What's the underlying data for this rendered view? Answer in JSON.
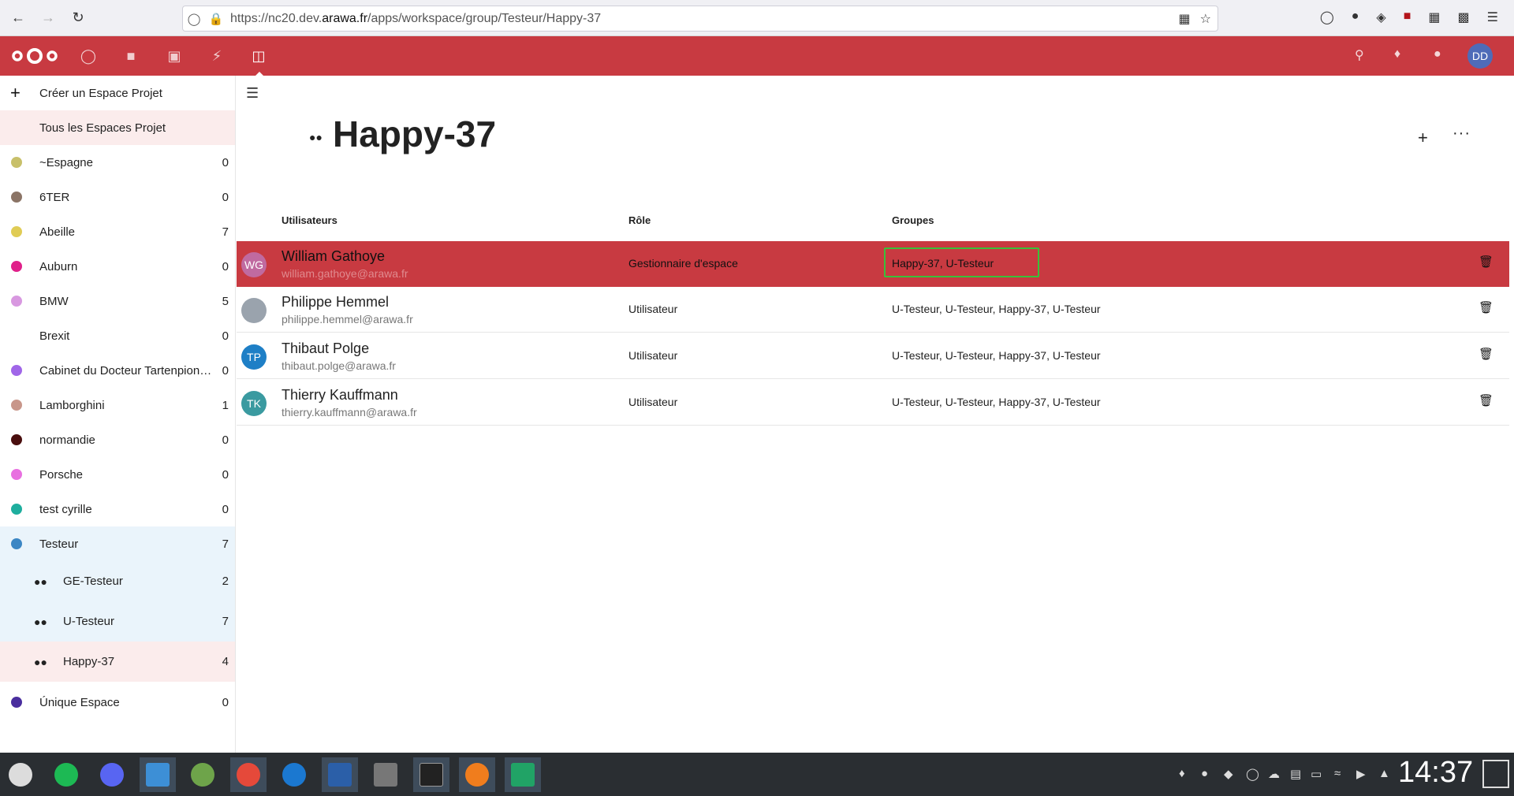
{
  "browser": {
    "url_prefix": "https://nc20.dev.",
    "url_domain": "arawa.fr",
    "url_path": "/apps/workspace/group/Testeur/Happy-37"
  },
  "header": {
    "user_initials": "DD",
    "apps": [
      "dashboard-icon",
      "files-icon",
      "photos-icon",
      "activity-icon",
      "workspace-icon"
    ]
  },
  "sidebar": {
    "create_label": "Créer un Espace Projet",
    "all_label": "Tous les Espaces Projet",
    "spaces": [
      {
        "name": "~Espagne",
        "count": "0",
        "color": "#c8c06a"
      },
      {
        "name": "6TER",
        "count": "0",
        "color": "#8b7466"
      },
      {
        "name": "Abeille",
        "count": "7",
        "color": "#e0cc55"
      },
      {
        "name": "Auburn",
        "count": "0",
        "color": "#e0208a"
      },
      {
        "name": "BMW",
        "count": "5",
        "color": "#d898e0"
      },
      {
        "name": "Brexit",
        "count": "0",
        "color": ""
      },
      {
        "name": "Cabinet du Docteur Tartenpion et ...",
        "count": "0",
        "color": "#a066e8"
      },
      {
        "name": "Lamborghini",
        "count": "1",
        "color": "#c8968a"
      },
      {
        "name": "normandie",
        "count": "0",
        "color": "#4a0e0e"
      },
      {
        "name": "Porsche",
        "count": "0",
        "color": "#e870e0"
      },
      {
        "name": "test cyrille",
        "count": "0",
        "color": "#1eae9e"
      },
      {
        "name": "Testeur",
        "count": "7",
        "color": "#3b86c4"
      }
    ],
    "subgroups": [
      {
        "name": "GE-Testeur",
        "count": "2"
      },
      {
        "name": "U-Testeur",
        "count": "7"
      },
      {
        "name": "Happy-37",
        "count": "4"
      }
    ],
    "last_space": {
      "name": "Únique Espace",
      "count": "0",
      "color": "#4a2e9e"
    }
  },
  "main": {
    "title": "Happy-37",
    "columns": {
      "users": "Utilisateurs",
      "role": "Rôle",
      "groups": "Groupes"
    },
    "rows": [
      {
        "initials": "WG",
        "avatar_color": "#c06aa0",
        "name": "William Gathoye",
        "email": "william.gathoye@arawa.fr",
        "role": "Gestionnaire d'espace",
        "groups": "Happy-37, U-Testeur"
      },
      {
        "initials": "",
        "avatar_color": "#9aa3ad",
        "name": "Philippe Hemmel",
        "email": "philippe.hemmel@arawa.fr",
        "role": "Utilisateur",
        "groups": "U-Testeur, U-Testeur, Happy-37, U-Testeur"
      },
      {
        "initials": "TP",
        "avatar_color": "#1e7fc6",
        "name": "Thibaut Polge",
        "email": "thibaut.polge@arawa.fr",
        "role": "Utilisateur",
        "groups": "U-Testeur, U-Testeur, Happy-37, U-Testeur"
      },
      {
        "initials": "TK",
        "avatar_color": "#3a9aa0",
        "name": "Thierry Kauffmann",
        "email": "thierry.kauffmann@arawa.fr",
        "role": "Utilisateur",
        "groups": "U-Testeur, U-Testeur, Happy-37, U-Testeur"
      }
    ]
  },
  "taskbar": {
    "clock": "14:37",
    "apps": [
      "app-launcher-icon",
      "spotify-icon",
      "discord-icon",
      "file-manager-icon",
      "keepass-icon",
      "chrome-icon",
      "thunderbird-icon",
      "remote-desktop-icon",
      "calculator-icon",
      "terminal-icon",
      "firefox-icon",
      "sheets-icon"
    ]
  }
}
